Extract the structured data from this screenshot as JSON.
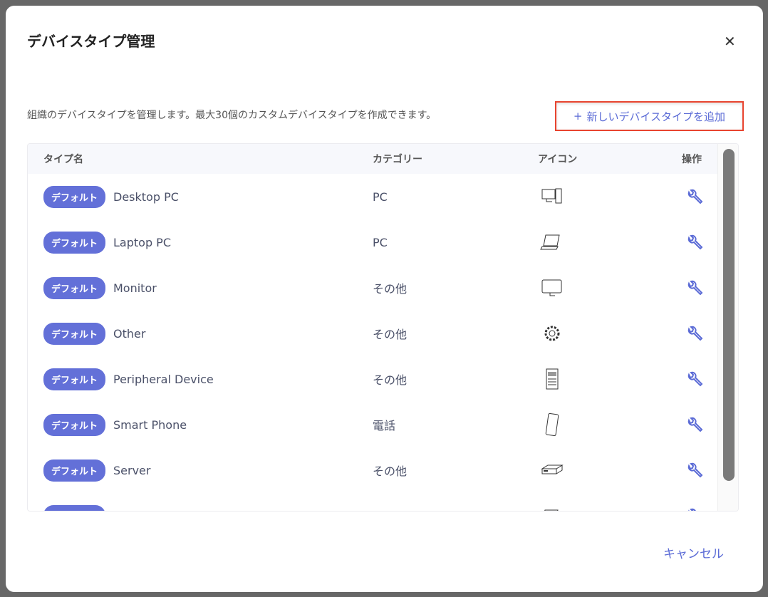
{
  "modal": {
    "title": "デバイスタイプ管理",
    "description": "組織のデバイスタイプを管理します。最大30個のカスタムデバイスタイプを作成できます。",
    "add_button": "新しいデバイスタイプを追加",
    "cancel": "キャンセル"
  },
  "table": {
    "headers": [
      "タイプ名",
      "カテゴリー",
      "アイコン",
      "操作"
    ],
    "rows": [
      {
        "badge": "デフォルト",
        "name": "Desktop PC",
        "category": "PC",
        "icon": "desktop-icon"
      },
      {
        "badge": "デフォルト",
        "name": "Laptop PC",
        "category": "PC",
        "icon": "laptop-icon"
      },
      {
        "badge": "デフォルト",
        "name": "Monitor",
        "category": "その他",
        "icon": "monitor-icon"
      },
      {
        "badge": "デフォルト",
        "name": "Other",
        "category": "その他",
        "icon": "gear-icon"
      },
      {
        "badge": "デフォルト",
        "name": "Peripheral Device",
        "category": "その他",
        "icon": "printer-icon"
      },
      {
        "badge": "デフォルト",
        "name": "Smart Phone",
        "category": "電話",
        "icon": "phone-icon"
      },
      {
        "badge": "デフォルト",
        "name": "Server",
        "category": "その他",
        "icon": "server-icon"
      },
      {
        "badge": "デフォルト",
        "name": "",
        "category": "",
        "icon": "device-icon"
      }
    ]
  }
}
